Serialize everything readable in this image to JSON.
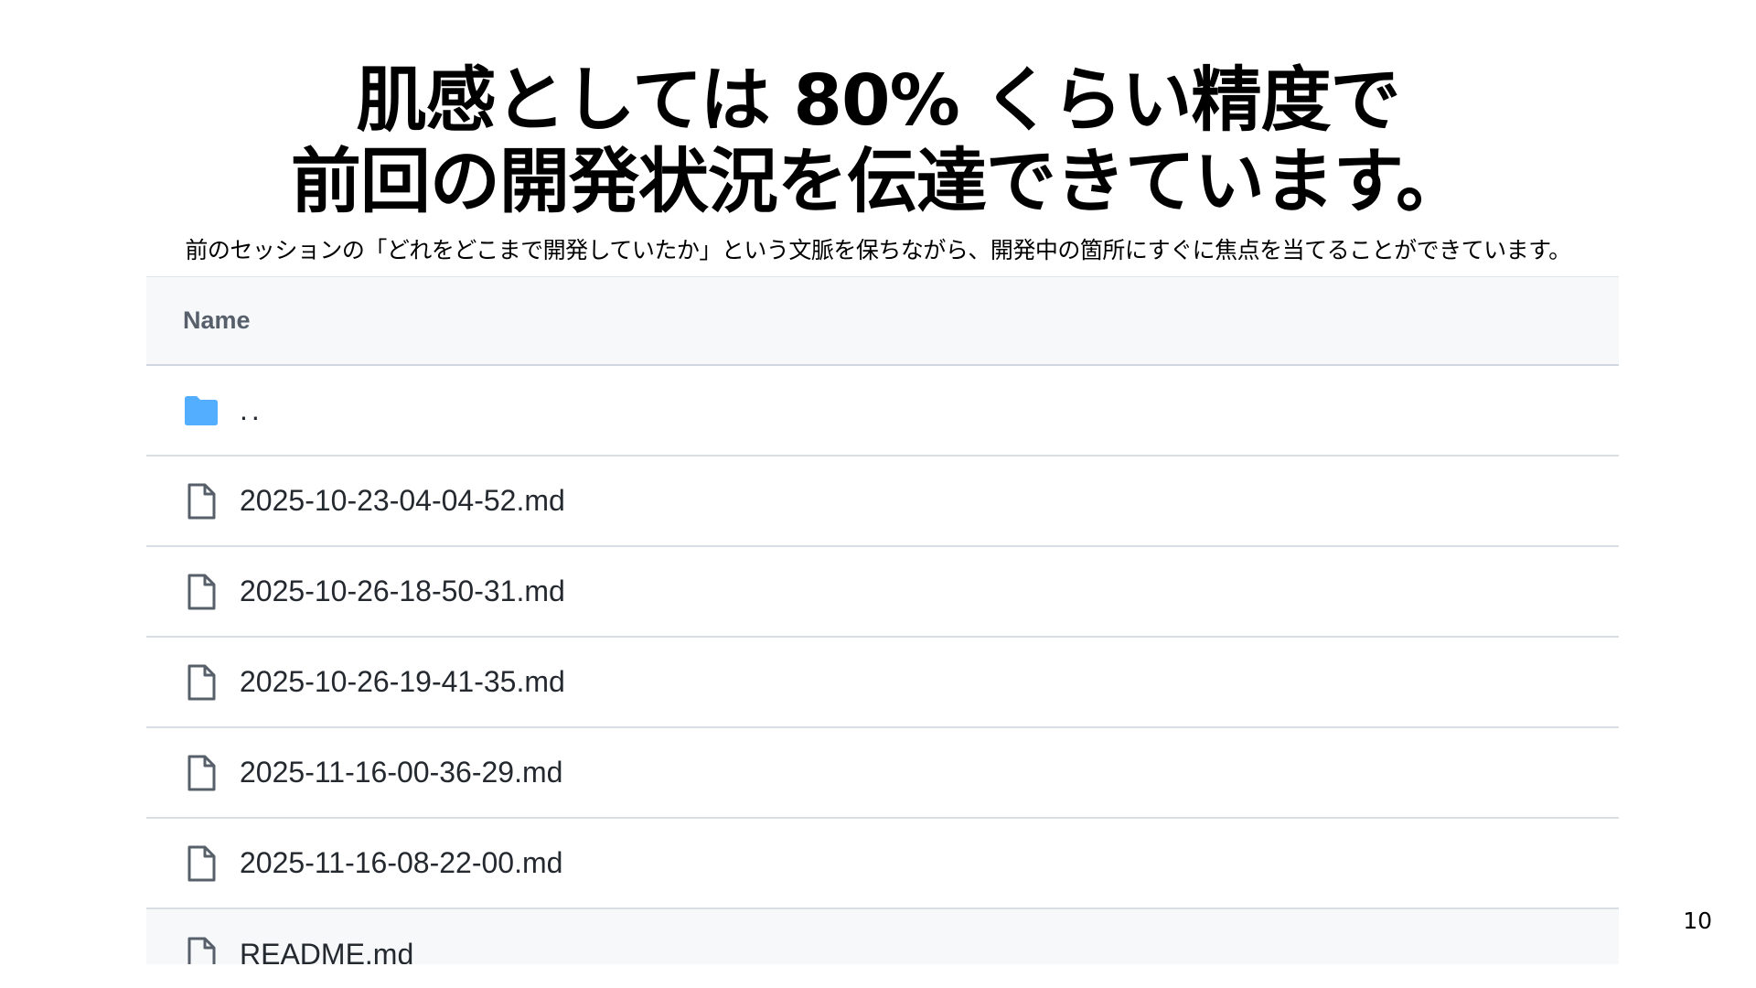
{
  "slide": {
    "title_line1": "肌感としては 80% くらい精度で",
    "title_line2": "前回の開発状況を伝達できています。",
    "subtitle": "前のセッションの「どれをどこまで開発していたか」という文脈を保ちながら、開発中の箇所にすぐに焦点を当てることができています。",
    "page_number": "10"
  },
  "file_list": {
    "header_name": "Name",
    "parent_dir": "..",
    "files": [
      {
        "name": "2025-10-23-04-04-52.md",
        "icon": "file-icon"
      },
      {
        "name": "2025-10-26-18-50-31.md",
        "icon": "file-icon"
      },
      {
        "name": "2025-10-26-19-41-35.md",
        "icon": "file-icon"
      },
      {
        "name": "2025-11-16-00-36-29.md",
        "icon": "file-icon"
      },
      {
        "name": "2025-11-16-08-22-00.md",
        "icon": "file-icon"
      },
      {
        "name": "README.md",
        "icon": "file-icon"
      }
    ],
    "colors": {
      "folder": "#54aeff",
      "file_icon": "#57606a",
      "header_bg": "#f6f8fa",
      "text": "#24292f"
    }
  }
}
